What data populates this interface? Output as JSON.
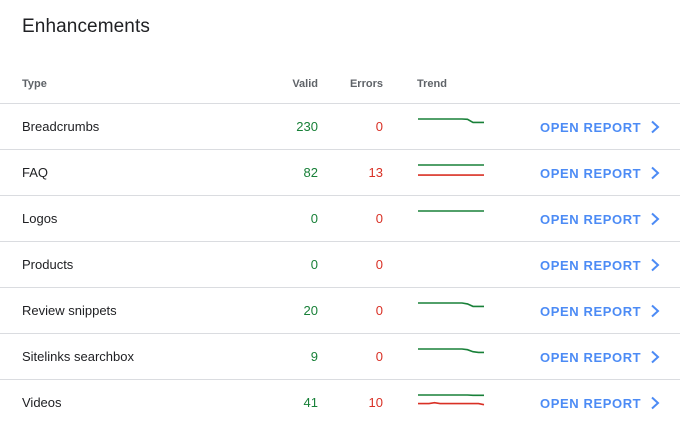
{
  "card": {
    "title": "Enhancements"
  },
  "table": {
    "headers": {
      "type": "Type",
      "valid": "Valid",
      "errors": "Errors",
      "trend": "Trend"
    },
    "action_label": "OPEN REPORT",
    "rows": [
      {
        "type": "Breadcrumbs",
        "valid": "230",
        "errors": "0",
        "trend": {
          "valid": [
            230,
            230,
            230,
            230,
            230,
            230,
            230,
            230,
            230,
            228,
            205,
            205,
            205
          ],
          "errors": []
        }
      },
      {
        "type": "FAQ",
        "valid": "82",
        "errors": "13",
        "trend": {
          "valid": [
            82,
            82,
            82,
            82,
            82,
            82,
            82,
            82,
            82,
            82,
            82,
            82,
            82
          ],
          "errors": [
            13,
            13,
            13,
            13,
            13,
            13,
            13,
            13,
            13,
            13,
            13,
            13,
            13
          ]
        }
      },
      {
        "type": "Logos",
        "valid": "0",
        "errors": "0",
        "trend": {
          "valid": [
            1,
            1,
            1,
            1,
            1,
            1,
            1,
            1,
            1,
            1,
            1,
            1,
            1
          ],
          "errors": []
        }
      },
      {
        "type": "Products",
        "valid": "0",
        "errors": "0",
        "trend": {
          "valid": [],
          "errors": []
        }
      },
      {
        "type": "Review snippets",
        "valid": "20",
        "errors": "0",
        "trend": {
          "valid": [
            24,
            24,
            24,
            24,
            24,
            24,
            24,
            24,
            24,
            23,
            20,
            20,
            20
          ],
          "errors": []
        }
      },
      {
        "type": "Sitelinks searchbox",
        "valid": "9",
        "errors": "0",
        "trend": {
          "valid": [
            14,
            14,
            14,
            14,
            14,
            14,
            14,
            14,
            14,
            13,
            10,
            9,
            9
          ],
          "errors": []
        }
      },
      {
        "type": "Videos",
        "valid": "41",
        "errors": "10",
        "trend": {
          "valid": [
            42,
            42,
            42,
            42,
            42,
            42,
            42,
            42,
            42,
            42,
            41,
            41,
            41
          ],
          "errors": [
            12,
            12,
            12,
            15,
            12,
            12,
            12,
            12,
            12,
            12,
            12,
            12,
            8
          ]
        }
      }
    ]
  },
  "colors": {
    "valid": "#188038",
    "errors": "#d93025",
    "link": "#4c8bf5"
  },
  "icons": {
    "row_action": "chevron-right-icon"
  }
}
